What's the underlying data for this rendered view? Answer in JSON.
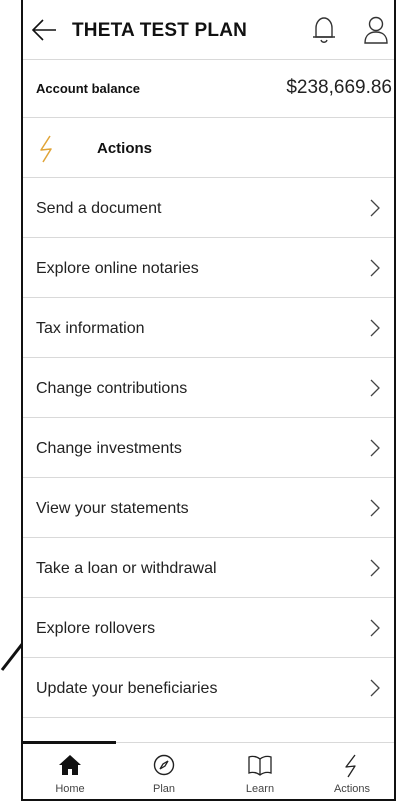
{
  "header": {
    "title": "THETA TEST PLAN",
    "back_icon": "arrow-left-icon",
    "notifications_icon": "bell-icon",
    "profile_icon": "user-icon"
  },
  "balance": {
    "label": "Account balance",
    "value": "$238,669.86"
  },
  "actions": {
    "title": "Actions",
    "icon": "bolt-icon",
    "items": [
      {
        "label": "Send a document"
      },
      {
        "label": "Explore online notaries"
      },
      {
        "label": "Tax information"
      },
      {
        "label": "Change contributions"
      },
      {
        "label": "Change investments"
      },
      {
        "label": "View your statements"
      },
      {
        "label": "Take a loan or withdrawal"
      },
      {
        "label": "Explore rollovers"
      },
      {
        "label": "Update your beneficiaries"
      }
    ]
  },
  "tabbar": {
    "selected": "Home",
    "tabs": [
      {
        "label": "Home",
        "icon": "home-icon"
      },
      {
        "label": "Plan",
        "icon": "compass-icon"
      },
      {
        "label": "Learn",
        "icon": "book-icon"
      },
      {
        "label": "Actions",
        "icon": "bolt-icon"
      }
    ]
  },
  "colors": {
    "text": "#111111",
    "divider": "#d9d9d9",
    "accent_icon": "#e0a437"
  }
}
